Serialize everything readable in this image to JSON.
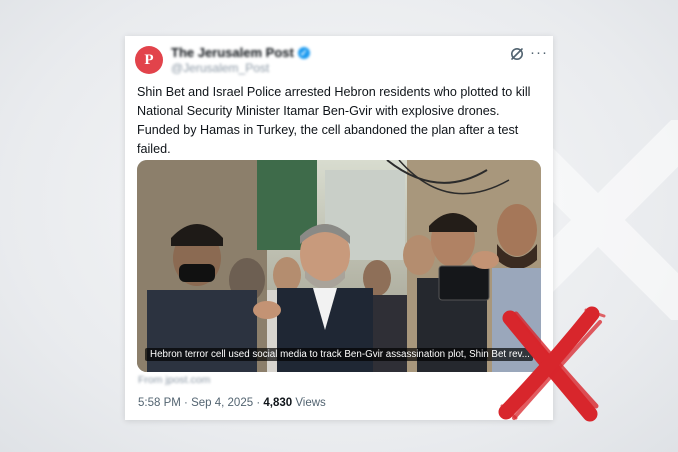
{
  "post": {
    "account_name": "The Jerusalem Post",
    "account_handle": "@Jerusalem_Post",
    "avatar_letter": "P",
    "verified_mark": "✓",
    "text": "Shin Bet and Israel Police arrested Hebron residents who plotted to kill National Security Minister Itamar Ben-Gvir with explosive drones. Funded by Hamas in Turkey, the cell abandoned the plan after a test failed.",
    "media_caption": "Hebron terror cell used social media to track Ben-Gvir assassination plot, Shin Bet rev...",
    "link_source": "From jpost.com",
    "time": "5:58 PM",
    "date": "Sep 4, 2025",
    "views_count": "4,830",
    "views_label": "Views",
    "separator": "·",
    "more_glyph": "···"
  },
  "icons": [
    "grok-icon",
    "more-icon",
    "verified-icon",
    "red-x-mark"
  ],
  "colors": {
    "brand_red": "#e2434b",
    "verified_blue": "#1d9bf0",
    "rejection_mark": "#d8262c"
  }
}
